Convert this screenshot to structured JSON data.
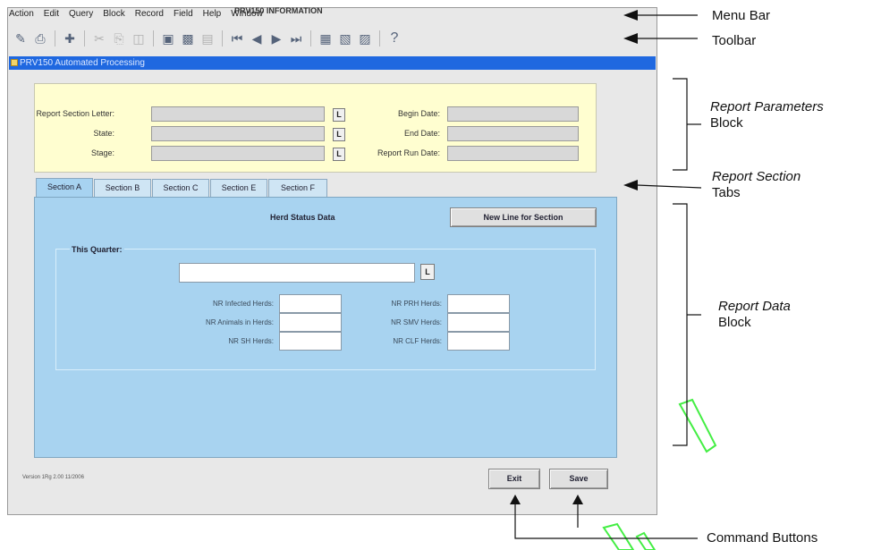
{
  "menu": [
    "Action",
    "Edit",
    "Query",
    "Block",
    "Record",
    "Field",
    "Help",
    "Window"
  ],
  "toolbar_icons": [
    "save-icon",
    "print-icon",
    "exit-icon",
    "cut-icon",
    "copy-icon",
    "paste-icon",
    "insert-record-icon",
    "remove-record-icon",
    "duplicate-record-icon",
    "first-record-icon",
    "previous-record-icon",
    "next-record-icon",
    "last-record-icon",
    "enter-query-icon",
    "execute-query-icon",
    "cancel-query-icon",
    "help-icon"
  ],
  "window_title": "PRV150 Automated Processing",
  "params": {
    "title": "PRV150 INFORMATION",
    "report_section_letter_label": "Report Section Letter:",
    "state_label": "State:",
    "stage_label": "Stage:",
    "begin_date_label": "Begin Date:",
    "end_date_label": "End Date:",
    "report_run_date_label": "Report Run Date:",
    "lov_label": "L"
  },
  "tabs": [
    "Section A",
    "Section B",
    "Section C",
    "Section E",
    "Section F"
  ],
  "data_block": {
    "title": "Herd Status Data",
    "new_line_button": "New Line for Section",
    "this_quarter_label": "This Quarter:",
    "lov_label": "L",
    "fields_left": [
      "NR Infected Herds:",
      "NR Animals in Herds:",
      "NR SH Herds:"
    ],
    "fields_right": [
      "NR PRH Herds:",
      "NR SMV Herds:",
      "NR CLF Herds:"
    ]
  },
  "version_text": "Version 1Rg 2.00 11/2006",
  "buttons": {
    "exit": "Exit",
    "save": "Save"
  },
  "callouts": {
    "menu_bar": "Menu Bar",
    "toolbar": "Toolbar",
    "report_parameters_line1": "Report Parameters",
    "report_parameters_line2": "Block",
    "report_section_line1": "Report Section",
    "report_section_line2": "Tabs",
    "report_data_line1": "Report Data",
    "report_data_line2": "Block",
    "command_buttons": "Command Buttons"
  },
  "colors": {
    "title_bar": "#1f68e0",
    "parameter_block": "#fffed0",
    "data_block": "#a8d3f0",
    "highlight_stroke": "#44ee44"
  }
}
